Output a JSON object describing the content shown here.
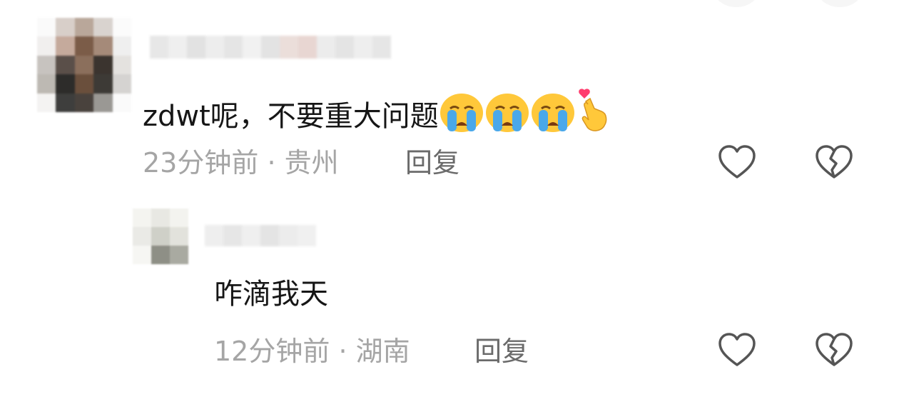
{
  "comments": [
    {
      "text": "zdwt呢，不要重大问题",
      "emojis": [
        "loudly-crying-face",
        "loudly-crying-face",
        "loudly-crying-face",
        "hand-with-index-finger-and-thumb-crossed"
      ],
      "time": "23分钟前",
      "location": "贵州",
      "reply_label": "回复"
    },
    {
      "text": "咋滴我天",
      "time": "12分钟前",
      "location": "湖南",
      "reply_label": "回复"
    }
  ],
  "separator": "·",
  "icons": {
    "like": "heart-outline-icon",
    "dislike": "broken-heart-outline-icon"
  },
  "colors": {
    "text": "#161616",
    "meta": "#a5a5a5",
    "reply": "#6b6b6b",
    "icon": "#555555"
  }
}
